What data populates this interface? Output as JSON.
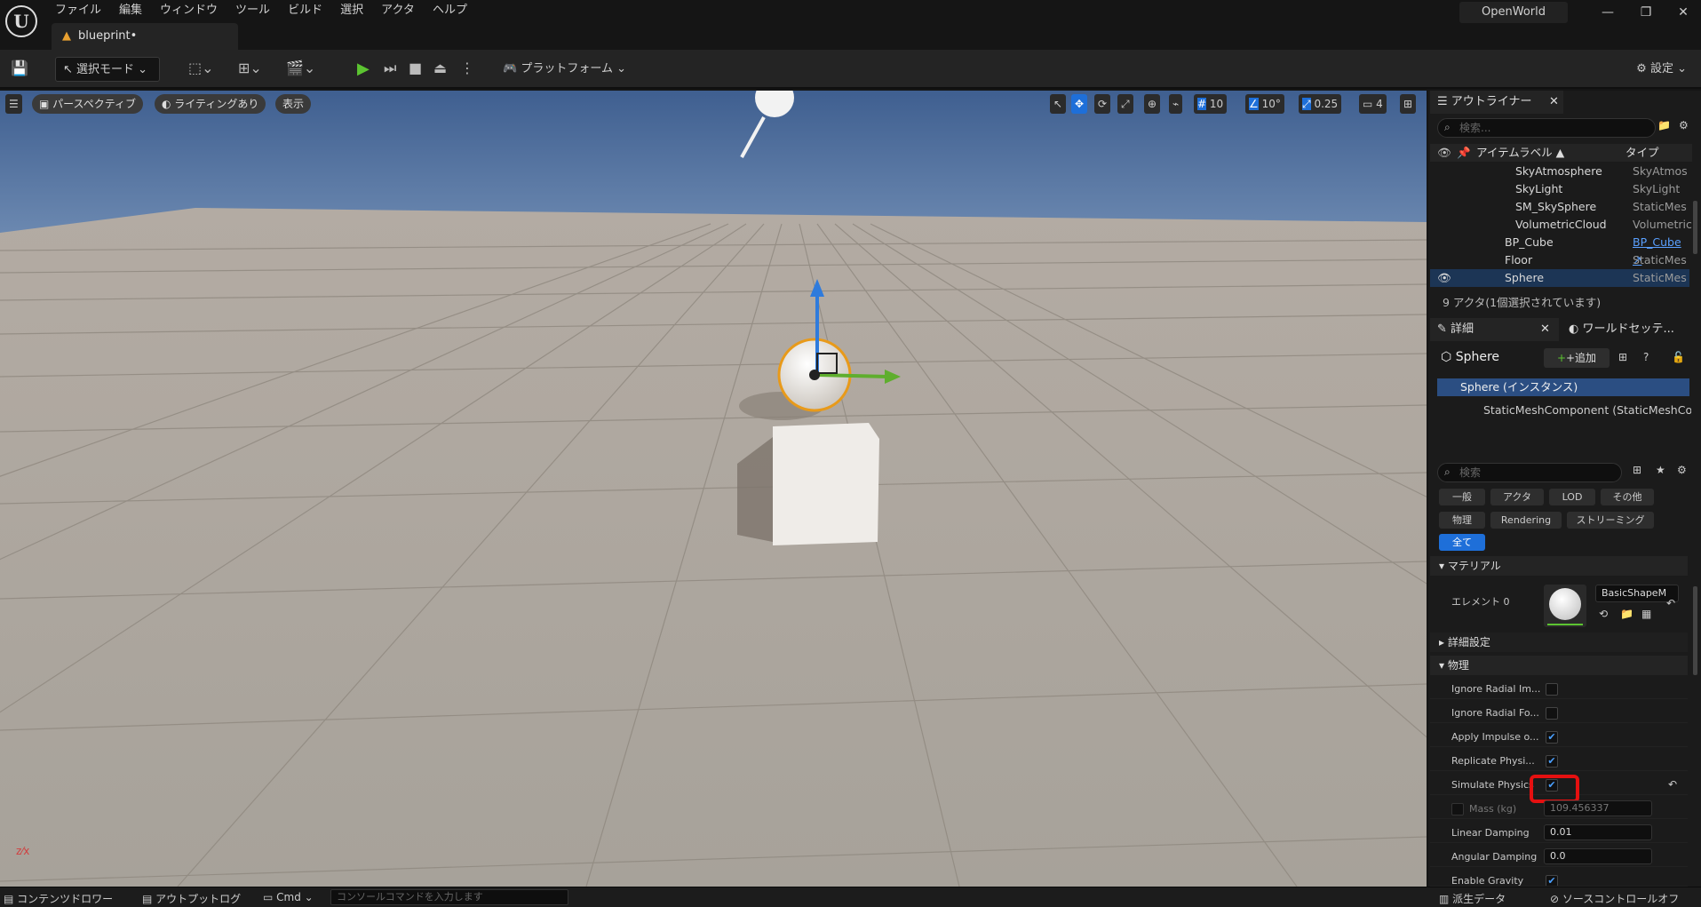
{
  "app": {
    "logo": "U",
    "project_name": "OpenWorld",
    "document_tab": "blueprint•"
  },
  "menu": [
    "ファイル",
    "編集",
    "ウィンドウ",
    "ツール",
    "ビルド",
    "選択",
    "アクタ",
    "ヘルプ"
  ],
  "toolbar": {
    "mode": "選択モード",
    "platform": "プラットフォーム",
    "settings": "設定"
  },
  "viewport": {
    "perspective": "パースペクティブ",
    "lighting": "ライティングあり",
    "show": "表示",
    "grid_snap": "10",
    "rotation_snap": "10°",
    "scale_snap": "0.25",
    "camera_speed": "4"
  },
  "outliner": {
    "title": "アウトライナー",
    "search_placeholder": "検索...",
    "col_label": "アイテムラベル ▲",
    "col_type": "タイプ",
    "rows": [
      {
        "label": "SkyAtmosphere",
        "type": "SkyAtmos"
      },
      {
        "label": "SkyLight",
        "type": "SkyLight"
      },
      {
        "label": "SM_SkySphere",
        "type": "StaticMes"
      },
      {
        "label": "VolumetricCloud",
        "type": "Volumetric"
      },
      {
        "label": "BP_Cube",
        "type": "BP_Cube ↗"
      },
      {
        "label": "Floor",
        "type": "StaticMes"
      },
      {
        "label": "Sphere",
        "type": "StaticMes"
      }
    ],
    "status": "9 アクタ(1個選択されています)"
  },
  "details": {
    "tab": "詳細",
    "world_tab": "ワールドセッテ...",
    "actor_name": "Sphere",
    "add_button": "+追加",
    "component_root": "Sphere (インスタンス)",
    "component_child": "StaticMeshComponent (StaticMeshComp",
    "search_placeholder": "検索",
    "filters": [
      "一般",
      "アクタ",
      "LOD",
      "その他",
      "物理",
      "Rendering",
      "ストリーミング",
      "全て"
    ],
    "section_material": "マテリアル",
    "element0_label": "エレメント 0",
    "material_name": "BasicShapeM",
    "advanced": "詳細設定",
    "section_physics": "物理",
    "physics_props": [
      {
        "label": "Ignore Radial Im...",
        "checked": false
      },
      {
        "label": "Ignore Radial Fo...",
        "checked": false
      },
      {
        "label": "Apply Impulse o...",
        "checked": true
      },
      {
        "label": "Replicate Physi...",
        "checked": true
      },
      {
        "label": "Simulate Physics",
        "checked": true
      }
    ],
    "mass_label": "Mass (kg)",
    "mass_value": "109.456337",
    "linear_damping_label": "Linear Damping",
    "linear_damping_value": "0.01",
    "angular_damping_label": "Angular Damping",
    "angular_damping_value": "0.0",
    "enable_gravity_label": "Enable Gravity"
  },
  "bottom": {
    "content_drawer": "コンテンツドロワー",
    "output_log": "アウトプットログ",
    "cmd": "Cmd",
    "console_placeholder": "コンソールコマンドを入力します",
    "derived_data": "派生データ",
    "source_control": "ソースコントロールオフ"
  }
}
